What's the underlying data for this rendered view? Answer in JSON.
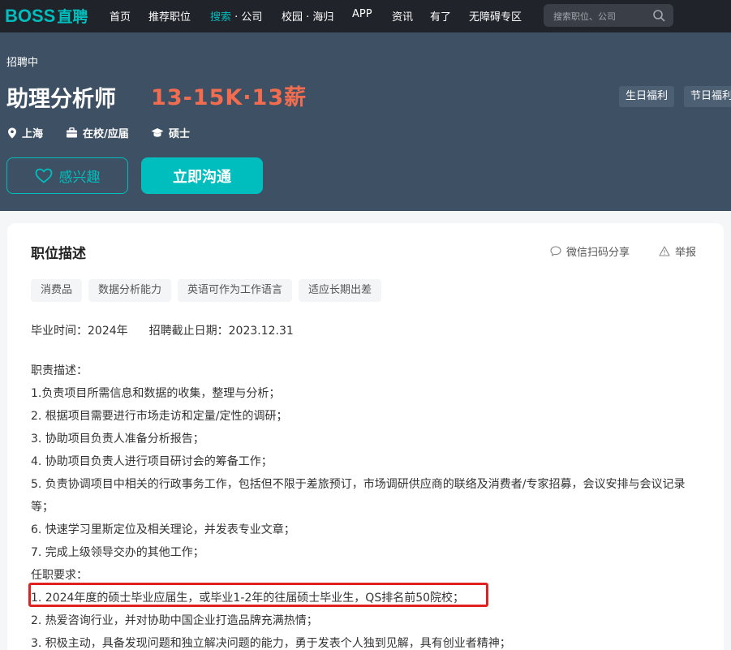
{
  "brand": {
    "logo_latin": "BOSS",
    "logo_cn": "直聘"
  },
  "nav": {
    "items": [
      {
        "label": "首页"
      },
      {
        "label": "推荐职位"
      },
      {
        "label": "搜索",
        "suffix": " · 公司"
      },
      {
        "label": "校园 · 海归"
      },
      {
        "label": "APP"
      },
      {
        "label": "资讯"
      },
      {
        "label": "有了"
      },
      {
        "label": "无障碍专区"
      }
    ],
    "search_placeholder": "搜索职位、公司"
  },
  "job": {
    "status": "招聘中",
    "title": "助理分析师",
    "salary": "13-15K·13薪",
    "benefits": [
      "生日福利",
      "节日福利"
    ],
    "location": "上海",
    "type": "在校/应届",
    "degree": "硕士",
    "interest_label": "感兴趣",
    "chat_label": "立即沟通"
  },
  "detail": {
    "heading": "职位描述",
    "share_label": "微信扫码分享",
    "report_label": "举报",
    "skills": [
      "消费品",
      "数据分析能力",
      "英语可作为工作语言",
      "适应长期出差"
    ],
    "grad_time": "毕业时间：2024年",
    "deadline": "招聘截止日期：2023.12.31",
    "lines": [
      "职责描述：",
      "1.负责项目所需信息和数据的收集，整理与分析；",
      "2. 根据项目需要进行市场走访和定量/定性的调研；",
      "3. 协助项目负责人准备分析报告；",
      "4. 协助项目负责人进行项目研讨会的筹备工作；",
      "5. 负责协调项目中相关的行政事务工作，包括但不限于差旅预订，市场调研供应商的联络及消费者/专家招募，会议安排与会议记录等；",
      "6. 快速学习里斯定位及相关理论，并发表专业文章；",
      "7. 完成上级领导交办的其他工作；",
      "任职要求：",
      "1. 2024年度的硕士毕业应届生，或毕业1-2年的往届硕士毕业生，QS排名前50院校；",
      "2. 热爱咨询行业，并对协助中国企业打造品牌充满热情；",
      "3. 积极主动，具备发现问题和独立解决问题的能力，勇于发表个人独到见解，具有创业者精神；"
    ]
  },
  "colors": {
    "brand": "#00bebd",
    "salary": "#f26d4f",
    "hero_bg": "#3e5064",
    "nav_bg": "#202329",
    "highlight": "#e12020"
  }
}
